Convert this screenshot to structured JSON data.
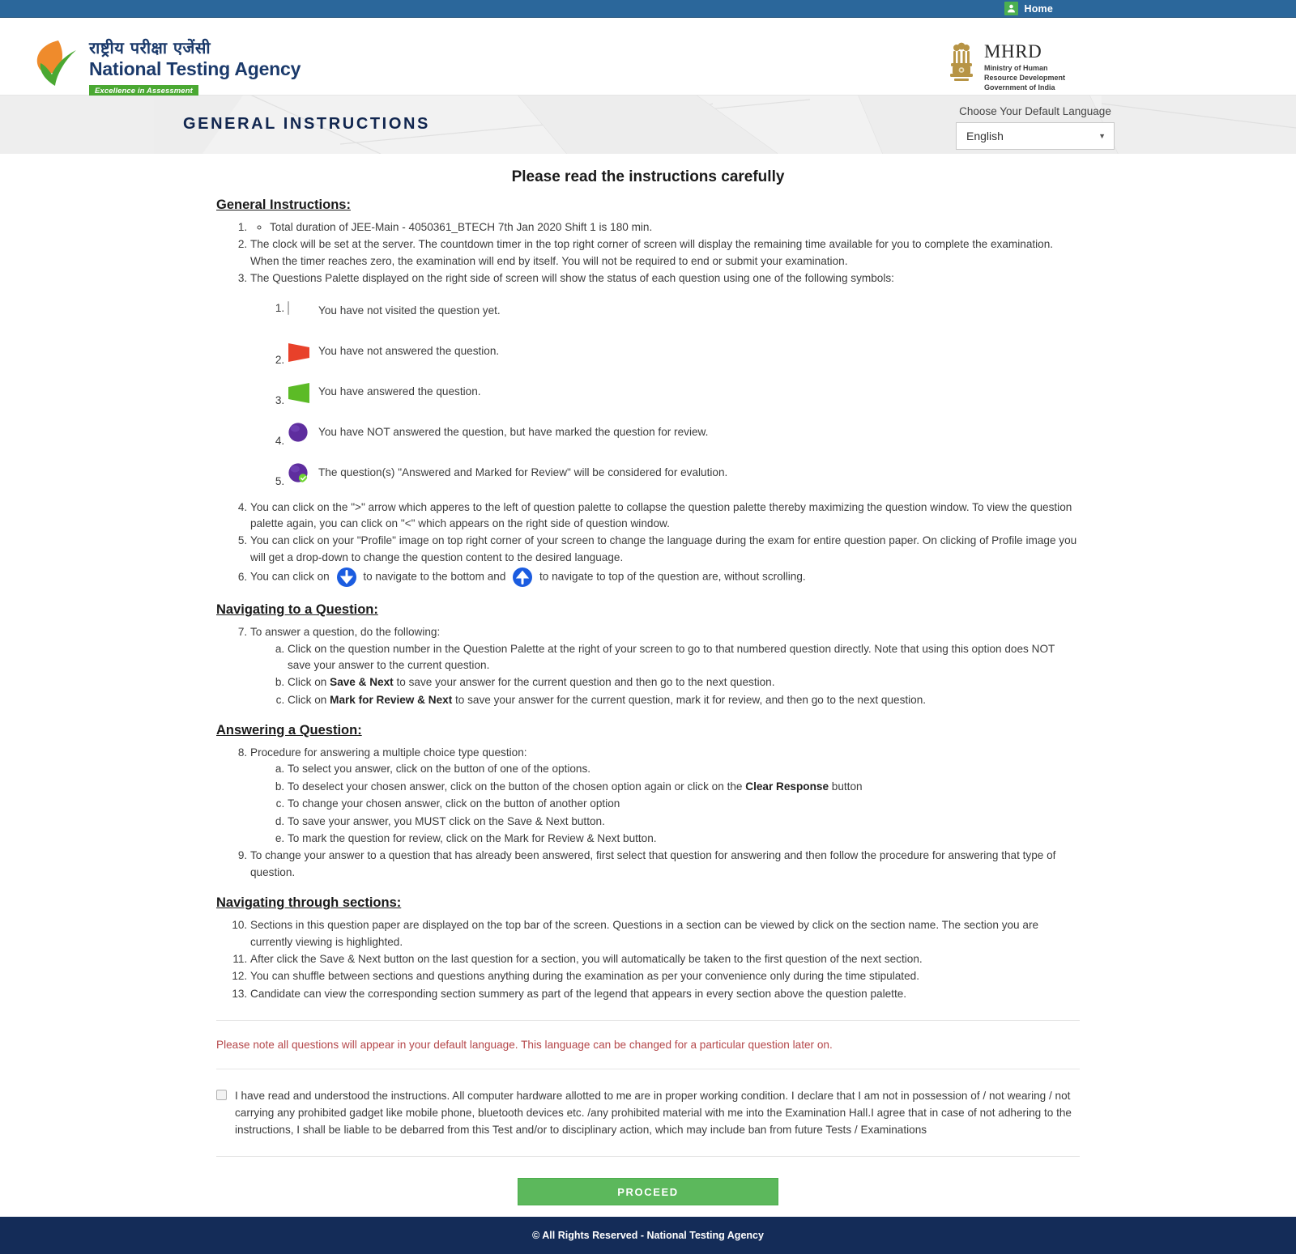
{
  "topbar": {
    "home_label": "Home",
    "home_icon": "person-icon"
  },
  "header": {
    "nta": {
      "hindi_name": "राष्ट्रीय परीक्षा एजेंसी",
      "english_name": "National Testing Agency",
      "tagline": "Excellence in Assessment"
    },
    "mhrd": {
      "title": "MHRD",
      "line1": "Ministry of Human",
      "line2": "Resource Development",
      "line3": "Government of India",
      "emblem_icon": "ashoka-emblem-icon"
    }
  },
  "banner": {
    "title": "GENERAL INSTRUCTIONS",
    "language_label": "Choose Your Default Language",
    "language_value": "English",
    "caret_icon": "chevron-down-icon"
  },
  "main": {
    "page_heading": "Please read the instructions carefully",
    "general_heading": "General Instructions:",
    "item1_sub": "Total duration of JEE-Main - 4050361_BTECH 7th Jan 2020 Shift 1 is 180 min.",
    "item2": "The clock will be set at the server. The countdown timer in the top right corner of screen will display the remaining time available for you to complete the examination. When the timer reaches zero, the examination will end by itself. You will not be required to end or submit your examination.",
    "item3": "The Questions Palette displayed on the right side of screen will show the status of each question using one of the following symbols:",
    "symbols": [
      {
        "icon": "not-visited-icon",
        "text": "You have not visited the question yet."
      },
      {
        "icon": "not-answered-icon",
        "text": "You have not answered the question."
      },
      {
        "icon": "answered-icon",
        "text": "You have answered the question."
      },
      {
        "icon": "marked-for-review-icon",
        "text": "You have NOT answered the question, but have marked the question for review."
      },
      {
        "icon": "answered-and-marked-icon",
        "text": "The question(s) \"Answered and Marked for Review\" will be considered for evalution."
      }
    ],
    "item4": "You can click on the \">\" arrow which apperes to the left of question palette to collapse the question palette thereby maximizing the question window. To view the question palette again, you can click on \"<\" which appears on the right side of question window.",
    "item5": "You can click on your \"Profile\" image on top right corner of your screen to change the language during the exam for entire question paper. On clicking of Profile image you will get a drop-down to change the question content to the desired language.",
    "item6_part1": "You can click on",
    "item6_part2": "to navigate to the bottom and",
    "item6_part3": "to navigate to top of the question are, without scrolling.",
    "navigating_heading": "Navigating to a Question:",
    "item7": "To answer a question, do the following:",
    "item7a": "Click on the question number in the Question Palette at the right of your screen to go to that numbered question directly. Note that using this option does NOT save your answer to the current question.",
    "item7b_pre": "Click on ",
    "item7b_bold": "Save & Next",
    "item7b_post": " to save your answer for the current question and then go to the next question.",
    "item7c_pre": "Click on ",
    "item7c_bold": "Mark for Review & Next",
    "item7c_post": " to save your answer for the current question, mark it for review, and then go to the next question.",
    "answering_heading": "Answering a Question:",
    "item8": "Procedure for answering a multiple choice type question:",
    "item8a": "To select you answer, click on the button of one of the options.",
    "item8b_pre": "To deselect your chosen answer, click on the button of the chosen option again or click on the ",
    "item8b_bold": "Clear Response",
    "item8b_post": " button",
    "item8c": "To change your chosen answer, click on the button of another option",
    "item8d": "To save your answer, you MUST click on the Save & Next button.",
    "item8e": "To mark the question for review, click on the Mark for Review & Next button.",
    "item9": "To change your answer to a question that has already been answered, first select that question for answering and then follow the procedure for answering that type of question.",
    "sections_heading": "Navigating through sections:",
    "item10": "Sections in this question paper are displayed on the top bar of the screen. Questions in a section can be viewed by click on the section name. The section you are currently viewing is highlighted.",
    "item11": "After click the Save & Next button on the last question for a section, you will automatically be taken to the first question of the next section.",
    "item12": "You can shuffle between sections and questions anything during the examination as per your convenience only during the time stipulated.",
    "item13": "Candidate can view the corresponding section summery as part of the legend that appears in every section above the question palette.",
    "note_red": "Please note all questions will appear in your default language. This language can be changed for a particular question later on.",
    "declaration": "I have read and understood the instructions. All computer hardware allotted to me are in proper working condition. I declare that I am not in possession of / not wearing / not carrying any prohibited gadget like mobile phone, bluetooth devices etc. /any prohibited material with me into the Examination Hall.I agree that in case of not adhering to the instructions, I shall be liable to be debarred from this Test and/or to disciplinary action, which may include ban from future Tests / Examinations",
    "proceed_label": "PROCEED"
  },
  "footer": {
    "text": "© All Rights Reserved - National Testing Agency"
  },
  "colors": {
    "topbar_blue": "#2b679b",
    "footer_navy": "#142c58",
    "proceed_green": "#5cb85c",
    "note_red": "#b5484b",
    "not_answered_red": "#e8412a",
    "answered_green": "#5cbb26",
    "review_purple": "#5e2d9e",
    "nav_arrow_blue": "#1b5ce0",
    "title_navy": "#11264f"
  }
}
